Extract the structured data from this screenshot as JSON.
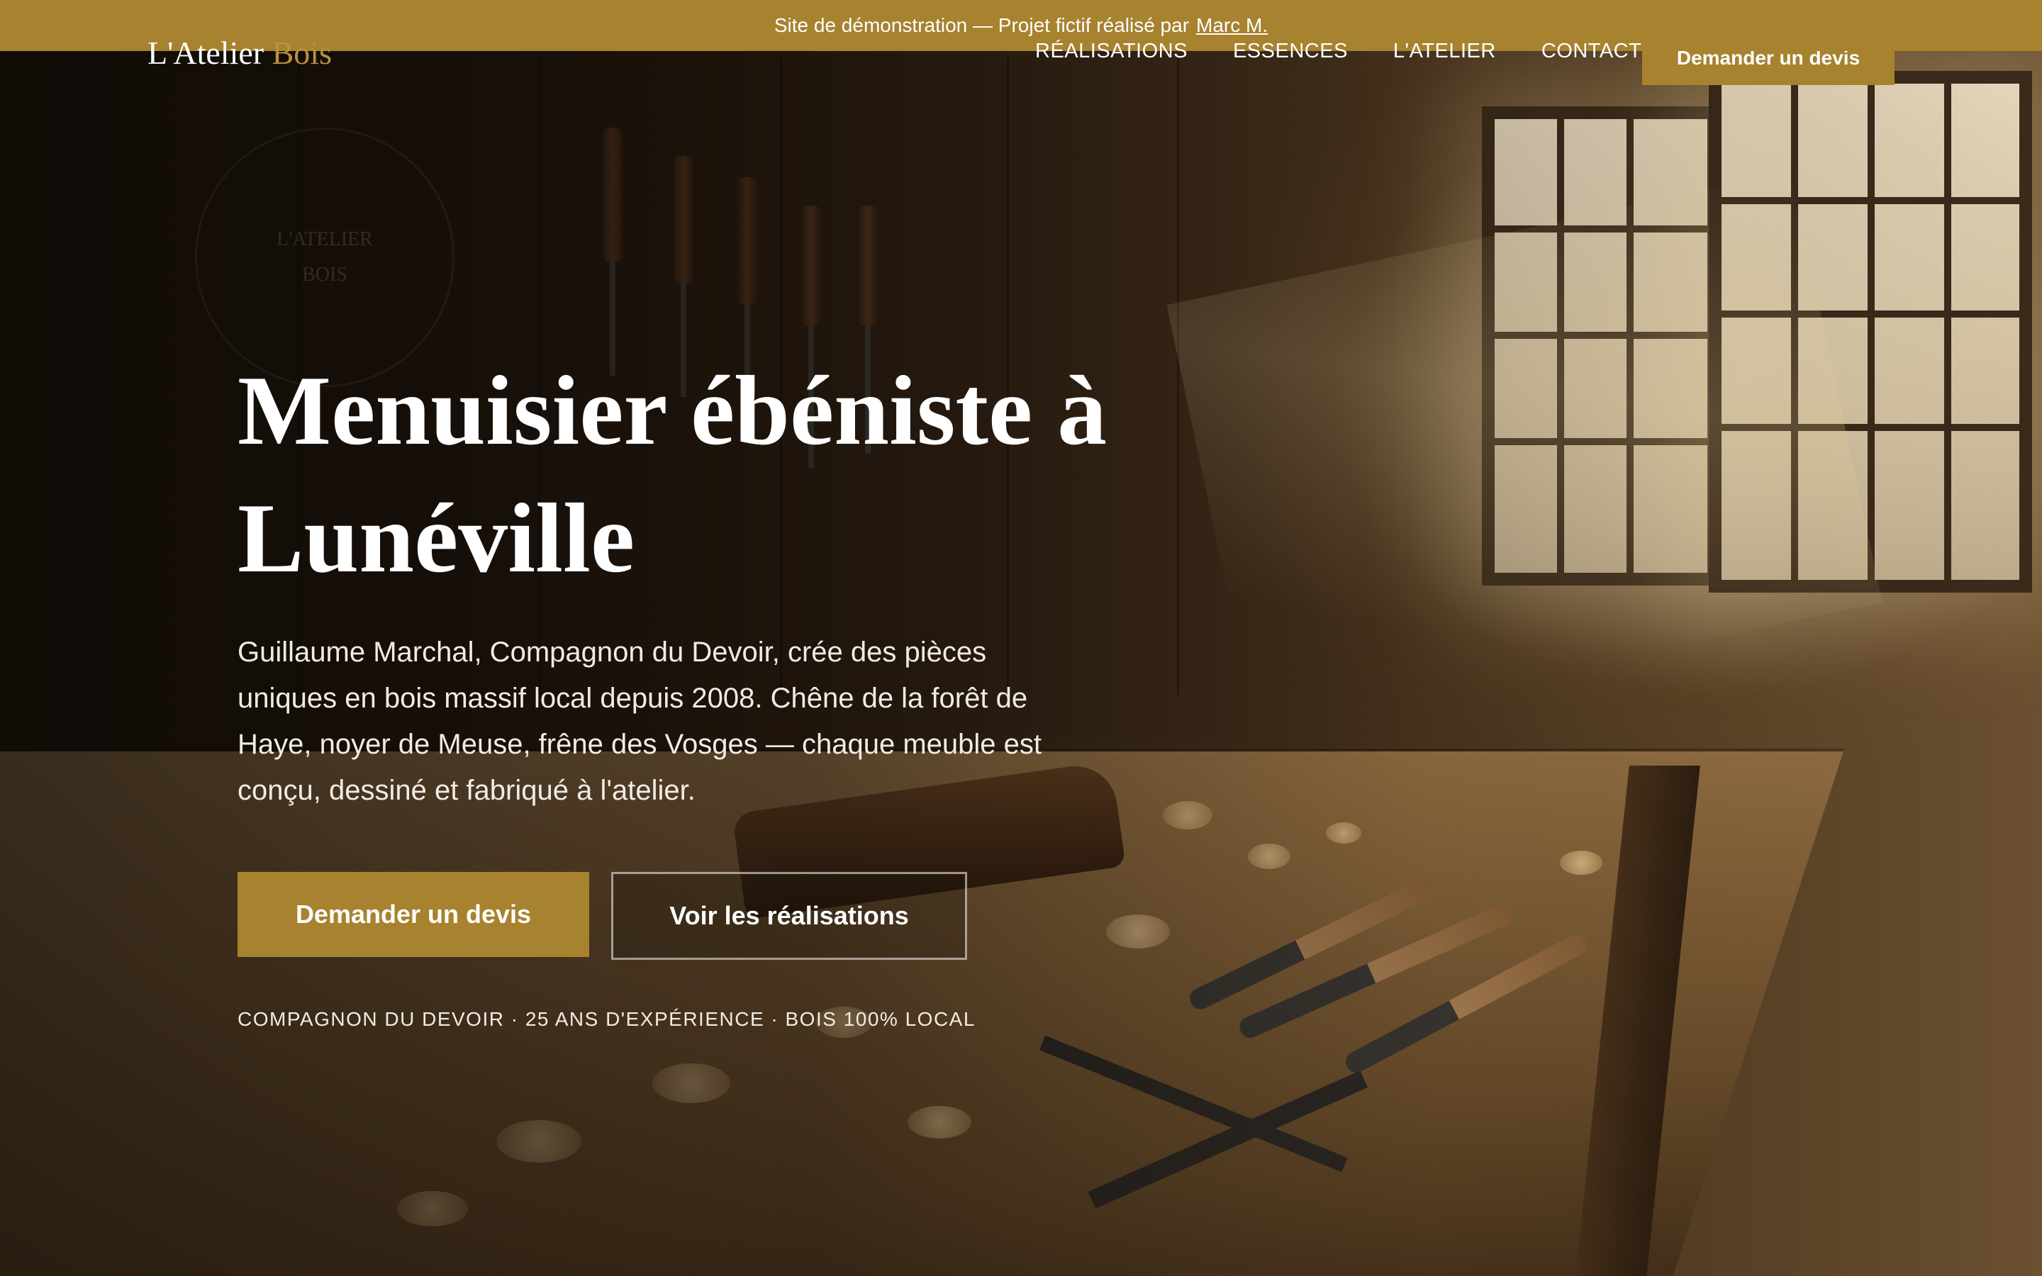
{
  "banner": {
    "text": "Site de démonstration — Projet fictif réalisé par",
    "author_link": "Marc M."
  },
  "header": {
    "logo_primary": "L'Atelier",
    "logo_accent": "Bois",
    "nav": [
      {
        "label": "RÉALISATIONS"
      },
      {
        "label": "ESSENCES"
      },
      {
        "label": "L'ATELIER"
      },
      {
        "label": "CONTACT"
      }
    ],
    "cta_label": "Demander un devis"
  },
  "hero": {
    "watermark_line1": "L'ATELIER",
    "watermark_line2": "BOIS",
    "title": "Menuisier ébéniste à Lunéville",
    "description": "Guillaume Marchal, Compagnon du Devoir, crée des pièces uniques en bois massif local depuis 2008. Chêne de la forêt de Haye, noyer de Meuse, frêne des Vosges — chaque meuble est conçu, dessiné et fabriqué à l'atelier.",
    "primary_button": "Demander un devis",
    "secondary_button": "Voir les réalisations",
    "tagline": "COMPAGNON DU DEVOIR · 25 ANS D'EXPÉRIENCE · BOIS 100% LOCAL"
  },
  "colors": {
    "accent": "#a7822f",
    "text": "#ffffff"
  }
}
